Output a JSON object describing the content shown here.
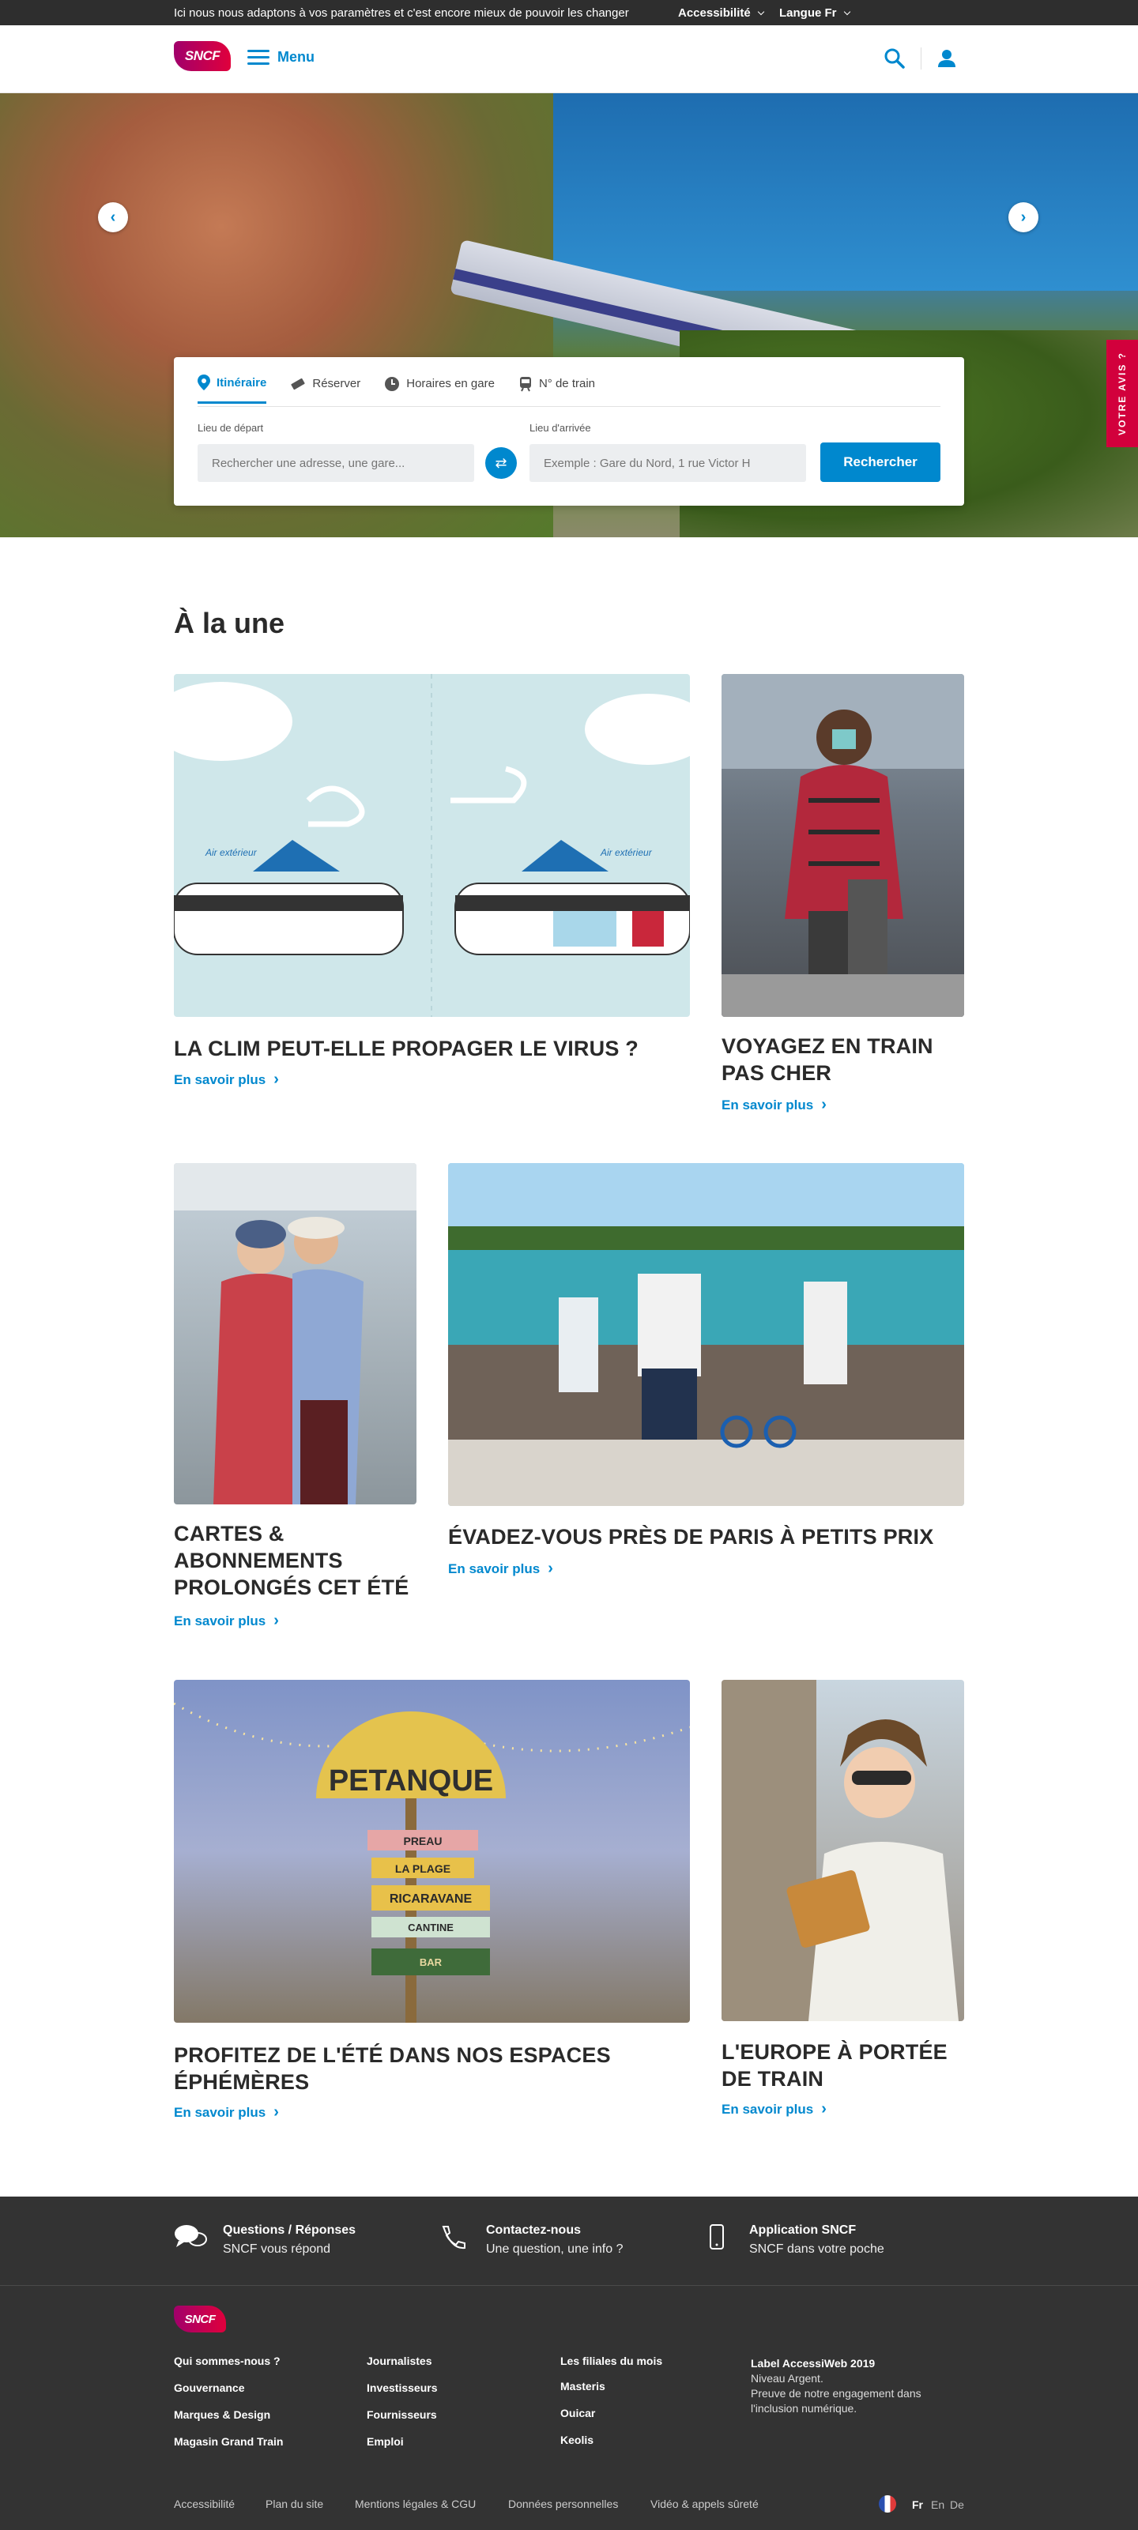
{
  "topbar": {
    "message": "Ici nous nous adaptons à vos paramètres et c'est encore mieux de pouvoir les changer",
    "accessibility": "Accessibilité",
    "language": "Langue Fr"
  },
  "header": {
    "logo": "SNCF",
    "menu": "Menu",
    "icons": [
      "search-icon",
      "user-icon"
    ]
  },
  "hero": {
    "carousel_dots": 5,
    "active_dot": 1,
    "feedback": "VOTRE AVIS ?"
  },
  "search": {
    "tabs": [
      {
        "label": "Itinéraire",
        "icon": "pin-icon",
        "active": true
      },
      {
        "label": "Réserver",
        "icon": "ticket-icon",
        "active": false
      },
      {
        "label": "Horaires en gare",
        "icon": "clock-icon",
        "active": false
      },
      {
        "label": "N° de train",
        "icon": "train-icon",
        "active": false
      }
    ],
    "departure_label": "Lieu de départ",
    "departure_placeholder": "Rechercher une adresse, une gare...",
    "arrival_label": "Lieu d'arrivée",
    "arrival_placeholder": "Exemple : Gare du Nord, 1 rue Victor H",
    "submit": "Rechercher"
  },
  "main": {
    "title": "À la une",
    "more_label": "En savoir plus",
    "cards": [
      {
        "title": "LA CLIM PEUT-ELLE PROPAGER LE VIRUS ?",
        "more": "En savoir plus",
        "image": "air-conditioning-illustration"
      },
      {
        "title": "VOYAGEZ EN TRAIN PAS CHER",
        "more": "En savoir plus",
        "image": "traveler-photo"
      },
      {
        "title": "CARTES & ABONNEMENTS PROLONGÉS CET ÉTÉ",
        "more": "En savoir plus",
        "image": "couple-photo"
      },
      {
        "title": "ÉVADEZ-VOUS PRÈS DE PARIS À PETITS PRIX",
        "more": "En savoir plus",
        "image": "lake-photo"
      },
      {
        "title": "PROFITEZ DE L'ÉTÉ DANS NOS ESPACES ÉPHÉMÈRES",
        "more": "En savoir plus",
        "image": "petanque-photo"
      },
      {
        "title": "L'EUROPE À PORTÉE DE TRAIN",
        "more": "En savoir plus",
        "image": "waffle-photo"
      }
    ],
    "illustration_text": "Air extérieur",
    "petanque_sign": "PETANQUE",
    "petanque_arrows": [
      "PREAU",
      "LA PLAGE",
      "RICARAVANE",
      "CANTINE",
      "BAR"
    ]
  },
  "footer_top": [
    {
      "title": "Questions / Réponses",
      "subtitle": "SNCF vous répond",
      "icon": "chat-icon"
    },
    {
      "title": "Contactez-nous",
      "subtitle": "Une question, une info ?",
      "icon": "phone-icon"
    },
    {
      "title": "Application SNCF",
      "subtitle": "SNCF dans votre poche",
      "icon": "mobile-icon"
    }
  ],
  "footer": {
    "logo": "SNCF",
    "col1": [
      "Qui sommes-nous ?",
      "Gouvernance",
      "Marques & Design",
      "Magasin Grand Train"
    ],
    "col2": [
      "Journalistes",
      "Investisseurs",
      "Fournisseurs",
      "Emploi"
    ],
    "col3_title": "Les filiales du mois",
    "col3": [
      "Masteris",
      "Ouicar",
      "Keolis"
    ],
    "label_title": "Label AccessiWeb 2019",
    "label_lines": [
      "Niveau Argent.",
      "Preuve de notre engagement dans",
      "l'inclusion numérique."
    ],
    "bottom_links": [
      "Accessibilité",
      "Plan du site",
      "Mentions légales & CGU",
      "Données personnelles",
      "Vidéo & appels sûreté"
    ],
    "languages": [
      "Fr",
      "En",
      "De"
    ]
  }
}
